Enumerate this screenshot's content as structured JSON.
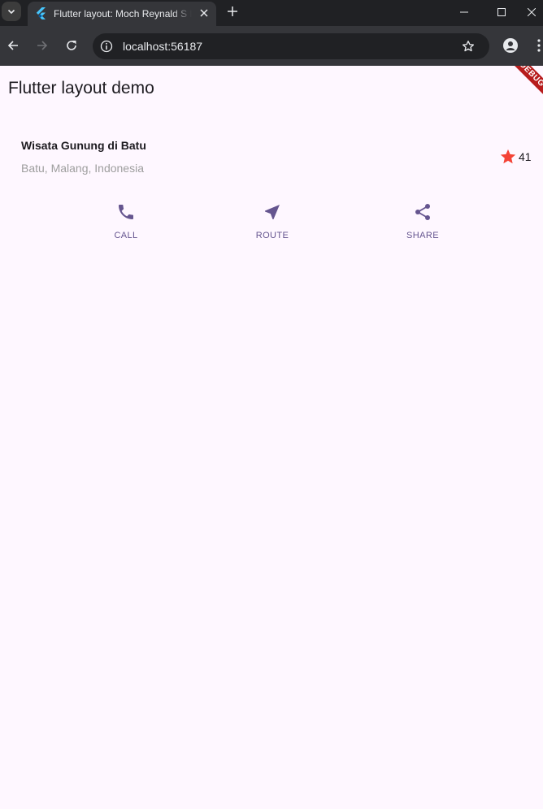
{
  "browser": {
    "tab_title": "Flutter layout: Moch Reynald S P",
    "url": "localhost:56187",
    "new_tab_symbol": "+",
    "icons": [
      "tab-list-icon",
      "flutter-logo-icon",
      "close-icon",
      "plus-icon",
      "minimize-icon",
      "maximize-icon",
      "window-close-icon",
      "back-icon",
      "forward-icon",
      "reload-icon",
      "info-icon",
      "star-outline-icon",
      "profile-icon",
      "kebab-menu-icon"
    ]
  },
  "app": {
    "title": "Flutter layout demo",
    "debug_banner": "DEBUG",
    "place": {
      "name": "Wisata Gunung di Batu",
      "location": "Batu, Malang, Indonesia",
      "rating_count": "41"
    },
    "actions": [
      {
        "label": "CALL",
        "icon": "phone-icon"
      },
      {
        "label": "ROUTE",
        "icon": "near-me-icon"
      },
      {
        "label": "SHARE",
        "icon": "share-icon"
      }
    ],
    "colors": {
      "primary": "#65558f",
      "star": "#f44336",
      "background": "#fef7ff",
      "subtitle": "#9e9e9e",
      "debug": "#b71c1c"
    }
  }
}
